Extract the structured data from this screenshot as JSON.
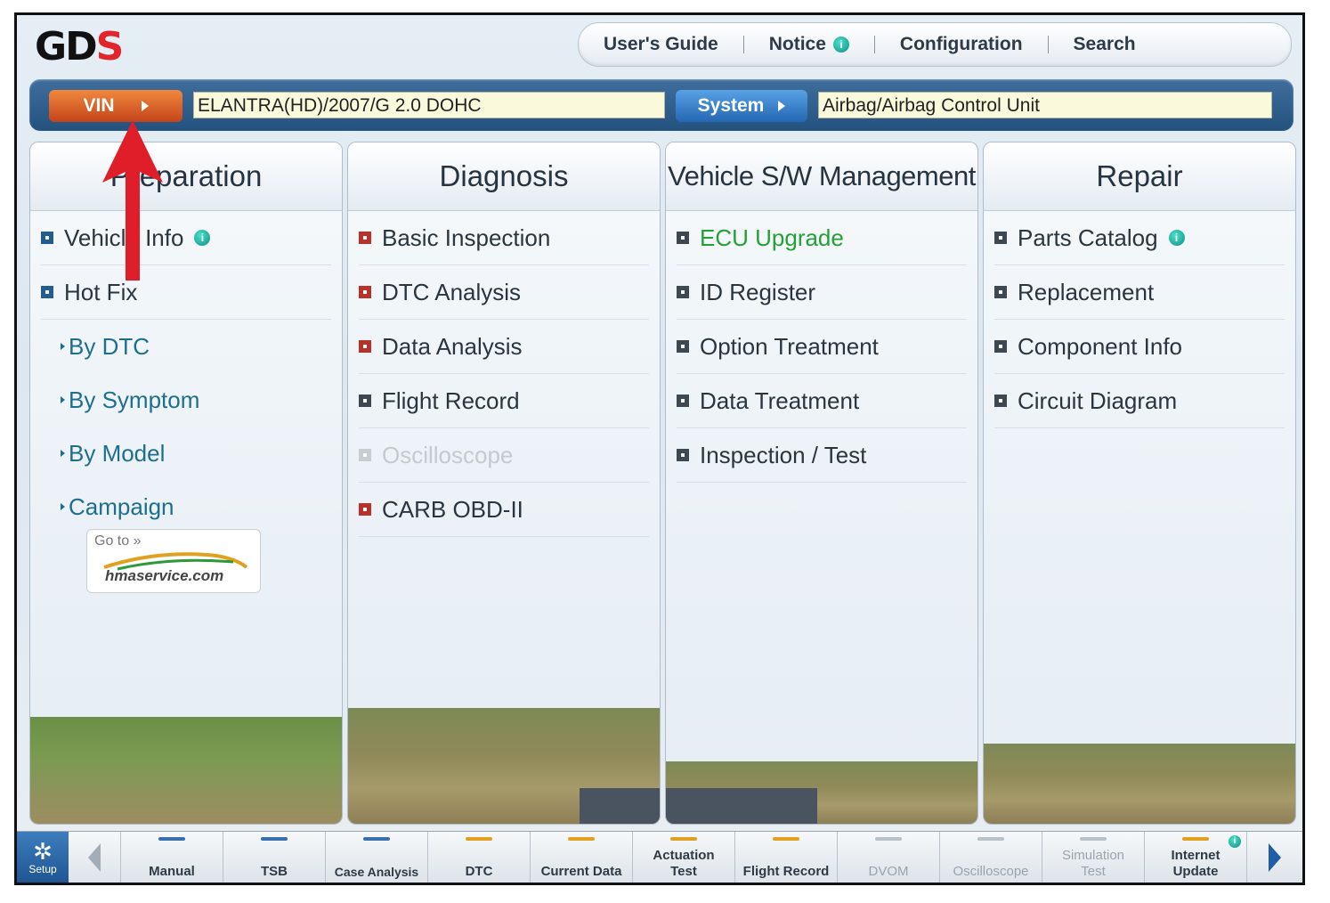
{
  "logo": {
    "text_main": "GD",
    "text_accent": "S"
  },
  "top_menu": {
    "users_guide": "User's Guide",
    "notice": "Notice",
    "configuration": "Configuration",
    "search": "Search",
    "info_glyph": "i"
  },
  "vin_bar": {
    "vin_label": "VIN",
    "vin_value": "ELANTRA(HD)/2007/G 2.0 DOHC",
    "system_label": "System",
    "system_value": "Airbag/Airbag Control Unit"
  },
  "panels": [
    {
      "title": "Preparation",
      "items": [
        {
          "label": "Vehicle Info",
          "info": true
        },
        {
          "label": "Hot Fix"
        },
        {
          "label": "By DTC",
          "sub": true
        },
        {
          "label": "By Symptom",
          "sub": true
        },
        {
          "label": "By Model",
          "sub": true
        },
        {
          "label": "Campaign",
          "sub": true
        }
      ]
    },
    {
      "title": "Diagnosis",
      "items": [
        {
          "label": "Basic Inspection"
        },
        {
          "label": "DTC Analysis"
        },
        {
          "label": "Data Analysis"
        },
        {
          "label": "Flight Record"
        },
        {
          "label": "Oscilloscope",
          "disabled": true
        },
        {
          "label": "CARB OBD-II"
        }
      ]
    },
    {
      "title": "Vehicle S/W Management",
      "items": [
        {
          "label": "ECU Upgrade",
          "highlight": true
        },
        {
          "label": "ID Register"
        },
        {
          "label": "Option Treatment"
        },
        {
          "label": "Data Treatment"
        },
        {
          "label": "Inspection / Test"
        }
      ]
    },
    {
      "title": "Repair",
      "items": [
        {
          "label": "Parts Catalog",
          "info": true
        },
        {
          "label": "Replacement"
        },
        {
          "label": "Component Info"
        },
        {
          "label": "Circuit Diagram"
        }
      ]
    }
  ],
  "hma_badge": {
    "go_to": "Go to »",
    "url": "hmaservice.com"
  },
  "toolbar": {
    "setup": "Setup",
    "tools": [
      {
        "label": "Manual",
        "bar": "#3a6fb0"
      },
      {
        "label": "TSB",
        "bar": "#3a6fb0"
      },
      {
        "label": "Case Analysis",
        "bar": "#3a6fb0"
      },
      {
        "label": "DTC",
        "bar": "#e0a020"
      },
      {
        "label": "Current Data",
        "bar": "#e0a020"
      },
      {
        "label": "Actuation Test",
        "bar": "#e0a020"
      },
      {
        "label": "Flight Record",
        "bar": "#e0a020"
      },
      {
        "label": "DVOM",
        "bar": "#b8c0c8",
        "disabled": true
      },
      {
        "label": "Oscilloscope",
        "bar": "#b8c0c8",
        "disabled": true
      },
      {
        "label": "Simulation Test",
        "bar": "#b8c0c8",
        "disabled": true
      },
      {
        "label": "Internet Update",
        "bar": "#e0a020",
        "info": true
      }
    ]
  },
  "colors": {
    "accent_red": "#e0262a",
    "vin_orange": "#e06a2c",
    "system_blue": "#2f7cc8",
    "highlight_green": "#25a035"
  },
  "icons": [
    "info-icon",
    "gear-icon",
    "chevron-left-icon",
    "chevron-right-icon",
    "bullet-square-icon",
    "red-arrow-annotation"
  ]
}
